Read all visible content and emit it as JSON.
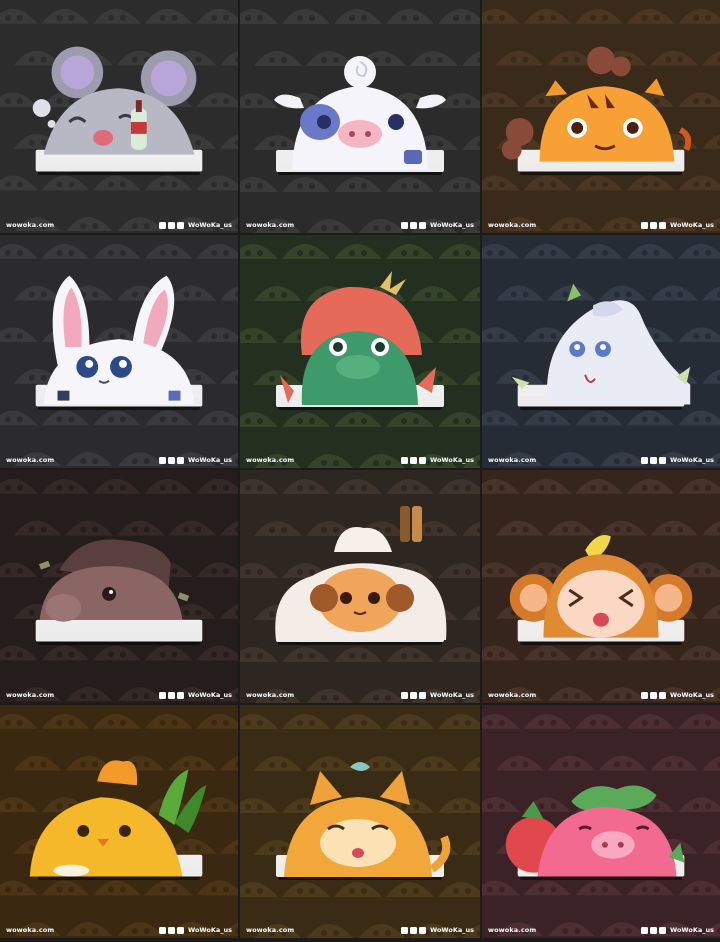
{
  "tiles": [
    {
      "subject": "rat",
      "website": "wowoka.com",
      "handle": "WoWoKa_us",
      "bg": "#2c2c2c",
      "pattern": "#3a3a3a"
    },
    {
      "subject": "ox",
      "website": "wowoka.com",
      "handle": "WoWoKa_us",
      "bg": "#2b2b2b",
      "pattern": "#3a3a3a"
    },
    {
      "subject": "tiger",
      "website": "wowoka.com",
      "handle": "WoWoKa_us",
      "bg": "#3a2a1a",
      "pattern": "#4a3622"
    },
    {
      "subject": "rabbit",
      "website": "wowoka.com",
      "handle": "WoWoKa_us",
      "bg": "#2b2b2e",
      "pattern": "#3a3a3e"
    },
    {
      "subject": "dragon",
      "website": "wowoka.com",
      "handle": "WoWoKa_us",
      "bg": "#24301f",
      "pattern": "#34442a"
    },
    {
      "subject": "snake",
      "website": "wowoka.com",
      "handle": "WoWoKa_us",
      "bg": "#262c36",
      "pattern": "#343c48"
    },
    {
      "subject": "horse",
      "website": "wowoka.com",
      "handle": "WoWoKa_us",
      "bg": "#251d1c",
      "pattern": "#342927"
    },
    {
      "subject": "goat",
      "website": "wowoka.com",
      "handle": "WoWoKa_us",
      "bg": "#2e2620",
      "pattern": "#3f342b"
    },
    {
      "subject": "monkey",
      "website": "wowoka.com",
      "handle": "WoWoKa_us",
      "bg": "#35251d",
      "pattern": "#47332a"
    },
    {
      "subject": "rooster",
      "website": "wowoka.com",
      "handle": "WoWoKa_us",
      "bg": "#3a2810",
      "pattern": "#4c3517"
    },
    {
      "subject": "dog",
      "website": "wowoka.com",
      "handle": "WoWoKa_us",
      "bg": "#3a2c14",
      "pattern": "#4c3a1c"
    },
    {
      "subject": "pig",
      "website": "wowoka.com",
      "handle": "WoWoKa_us",
      "bg": "#3a2226",
      "pattern": "#4c2e33"
    }
  ]
}
